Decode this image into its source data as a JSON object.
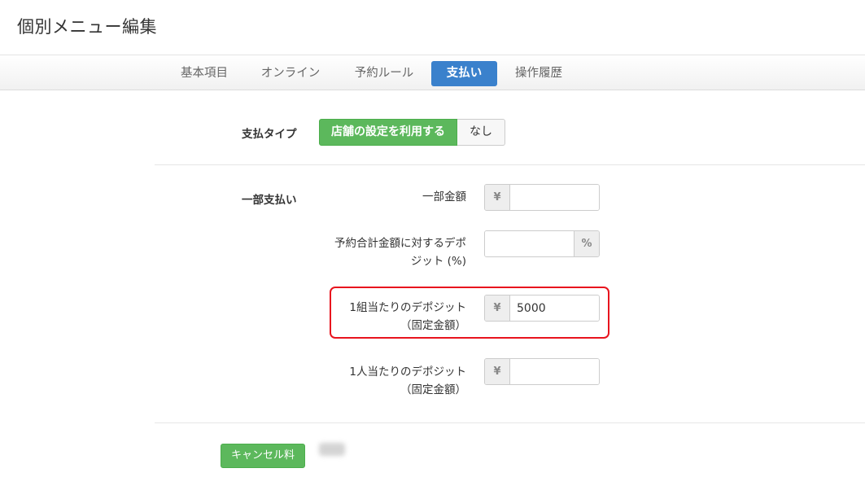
{
  "page_title": "個別メニュー編集",
  "tabs": [
    {
      "label": "基本項目"
    },
    {
      "label": "オンライン"
    },
    {
      "label": "予約ルール"
    },
    {
      "label": "支払い",
      "active": true
    },
    {
      "label": "操作履歴"
    }
  ],
  "payment_type": {
    "label": "支払タイプ",
    "options": [
      "店舗の設定を利用する",
      "なし"
    ],
    "selected": "店舗の設定を利用する"
  },
  "partial_payment": {
    "section_label": "一部支払い",
    "fields": [
      {
        "label": "一部金額",
        "prefix": "¥",
        "value": ""
      },
      {
        "label_lines": [
          "予約合計金額に対するデポ",
          "ジット (%)"
        ],
        "suffix": "%",
        "value": ""
      },
      {
        "label_lines": [
          "1組当たりのデポジット",
          "（固定金額）"
        ],
        "prefix": "¥",
        "value": "5000"
      },
      {
        "label_lines": [
          "1人当たりのデポジット",
          "（固定金額）"
        ],
        "prefix": "¥",
        "value": ""
      }
    ]
  },
  "cancel_fee": {
    "label": "キャンセル料"
  },
  "colors": {
    "accent": "#3a81cc",
    "success": "#5cb85c",
    "highlight": "#e8141e"
  }
}
